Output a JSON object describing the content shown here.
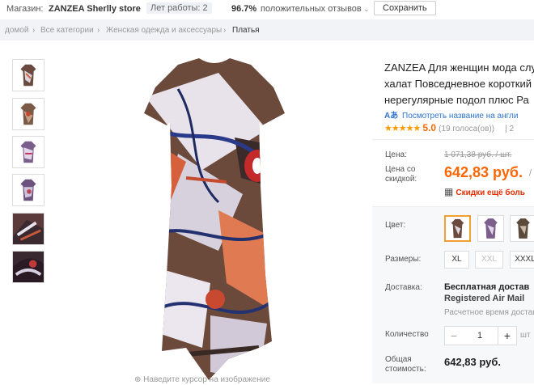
{
  "store": {
    "label": "Магазин:",
    "name": "ZANZEA Sherlly store",
    "years": "Лет работы: 2",
    "rating_pct": "96.7%",
    "rating_text": "положительных отзывов",
    "save": "Сохранить"
  },
  "breadcrumb": {
    "home": "домой",
    "all": "Все категории",
    "women": "Женская одежда и аксессуары",
    "current": "Платья",
    "sep": "›"
  },
  "product": {
    "title_lines": [
      "ZANZEA Для женщин мода слу",
      "халат Повседневное короткий",
      "нерегулярные подол плюс Ра"
    ],
    "translate_link": "Посмотреть название на англи",
    "stars": "★★★★★",
    "rating": "5.0",
    "votes": "(19 голоса(ов))",
    "orders_sep": "| 2",
    "price_label": "Цена:",
    "old_price": "1 071,38 руб. / шт.",
    "discount_label_1": "Цена со",
    "discount_label_2": "скидкой:",
    "price": "642,83 руб.",
    "price_suffix": "/",
    "coupon": "Скидки ещё боль",
    "color_label": "Цвет:",
    "sizes_label": "Размеры:",
    "sizes": [
      "XL",
      "XXL",
      "XXXL"
    ],
    "shipping_label": "Доставка:",
    "shipping_free": "Бесплатная достав",
    "shipping_method": "Registered Air Mail",
    "shipping_time": "Расчетное время достав",
    "qty_label": "Количество",
    "qty_minus": "−",
    "qty_value": "1",
    "qty_plus": "+",
    "qty_unit": "шт",
    "total_label_1": "Общая",
    "total_label_2": "стоимость:",
    "total": "642,83 руб.",
    "image_hint": "Наведите курсор на изображение"
  },
  "colors": {
    "accent": "#f60",
    "brand_red": "#e62e04",
    "link": "#2e73d0",
    "selected": "#f0a030",
    "star": "#ff9a00"
  }
}
